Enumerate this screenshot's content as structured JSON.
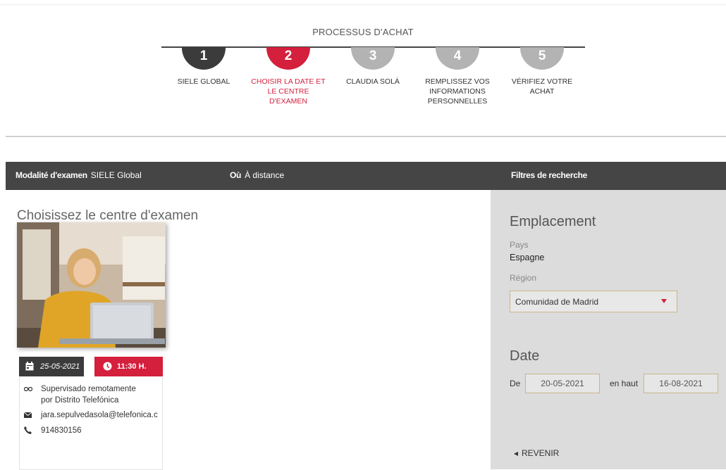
{
  "process": {
    "title": "PROCESSUS D'ACHAT",
    "steps": [
      {
        "number": "1",
        "label": "SIELE GLOBAL",
        "state": "done"
      },
      {
        "number": "2",
        "label": "CHOISIR LA DATE ET LE CENTRE D'EXAMEN",
        "state": "active"
      },
      {
        "number": "3",
        "label": "CLAUDIA SOLÁ",
        "state": "todo"
      },
      {
        "number": "4",
        "label": "REMPLISSEZ VOS INFORMATIONS PERSONNELLES",
        "state": "todo"
      },
      {
        "number": "5",
        "label": "VÉRIFIEZ VOTRE ACHAT",
        "state": "todo"
      }
    ]
  },
  "filterbar": {
    "modality_label": "Modalité d'examen",
    "modality_value": "SIELE Global",
    "where_label": "Où",
    "where_value": "À distance",
    "filters_label": "Filtres de recherche"
  },
  "main": {
    "title": "Choisissez le centre d'examen",
    "card": {
      "date": "25-05-2021",
      "time": "11:30 H.",
      "supervision": "Supervisado remotamente",
      "supervisor": "por Distrito Telefónica",
      "email": "jara.sepulvedasola@telefonica.c",
      "phone": "914830156"
    }
  },
  "panel": {
    "location_heading": "Emplacement",
    "country_label": "Pays",
    "country_value": "Espagne",
    "region_label": "Région",
    "region_value": "Comunidad de Madrid",
    "date_heading": "Date",
    "from_label": "De",
    "from_value": "20-05-2021",
    "to_label": "en haut",
    "to_value": "16-08-2021",
    "back_label": "REVENIR"
  },
  "colors": {
    "accent": "#d41f3d",
    "dark": "#3b3b3b",
    "todo": "#b3b3b3",
    "panel": "#dcdcdc"
  }
}
